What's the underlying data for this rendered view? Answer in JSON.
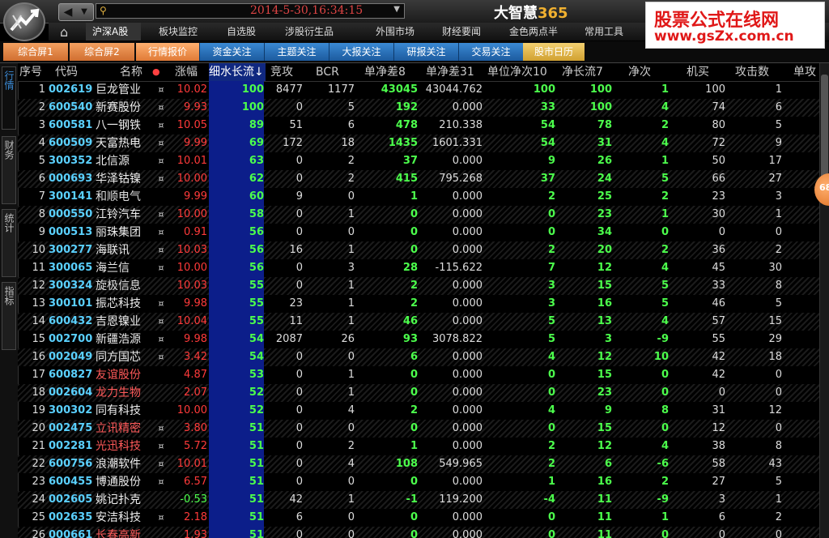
{
  "topbar": {
    "nav_back": "◀",
    "nav_forward": "▼",
    "clock": "2014-5-30,16:34:15",
    "app_title": "大智慧",
    "app_title_num": "365",
    "banner_title": "股票公式在线网",
    "banner_url": "www.gsZx.com.cn"
  },
  "menu": [
    "沪深A股",
    "板块监控",
    "自选股",
    "涉股衍生品",
    "外围市场",
    "财经要闻",
    "金色两点半",
    "常用工具"
  ],
  "tabs": [
    "综合屏1",
    "综合屏2",
    "行情报价",
    "资金关注",
    "主题关注",
    "大报关注",
    "研报关注",
    "交易关注",
    "股市日历"
  ],
  "sidetabs": [
    "行情",
    "财务",
    "统计",
    "指标"
  ],
  "float_label": "68",
  "columns": [
    "序号",
    "代码",
    "名称",
    "●",
    "涨幅",
    "细水长流↓",
    "竞攻",
    "BCR",
    "单净差8",
    "单净差31",
    "单位净次10",
    "净长流7",
    "净次",
    "机买",
    "攻击数",
    "单攻"
  ],
  "rows": [
    [
      "1",
      "002619",
      "巨龙管业",
      "¤",
      "10.02",
      "100",
      "8477",
      "1177",
      "43045",
      "43044.762",
      "100",
      "100",
      "1",
      "100",
      "1"
    ],
    [
      "2",
      "600540",
      "新赛股份",
      "¤",
      "9.93",
      "100",
      "0",
      "5",
      "192",
      "0.000",
      "33",
      "100",
      "4",
      "74",
      "6"
    ],
    [
      "3",
      "600581",
      "八一钢铁",
      "¤",
      "10.05",
      "89",
      "51",
      "6",
      "478",
      "210.338",
      "54",
      "78",
      "2",
      "80",
      "5"
    ],
    [
      "4",
      "600509",
      "天富热电",
      "¤",
      "9.99",
      "69",
      "172",
      "18",
      "1435",
      "1601.331",
      "54",
      "31",
      "4",
      "72",
      "9"
    ],
    [
      "5",
      "300352",
      "北信源",
      "¤",
      "10.01",
      "63",
      "0",
      "2",
      "37",
      "0.000",
      "9",
      "26",
      "1",
      "50",
      "17"
    ],
    [
      "6",
      "000693",
      "华泽钴镍",
      "¤",
      "10.00",
      "62",
      "0",
      "2",
      "415",
      "795.268",
      "37",
      "24",
      "5",
      "66",
      "27"
    ],
    [
      "7",
      "300141",
      "和顺电气",
      "",
      "9.99",
      "60",
      "9",
      "0",
      "1",
      "0.000",
      "2",
      "25",
      "2",
      "23",
      "3"
    ],
    [
      "8",
      "000550",
      "江铃汽车",
      "¤",
      "10.00",
      "58",
      "0",
      "1",
      "0",
      "0.000",
      "0",
      "23",
      "1",
      "30",
      "1"
    ],
    [
      "9",
      "000513",
      "丽珠集团",
      "¤",
      "0.91",
      "56",
      "0",
      "0",
      "0",
      "0.000",
      "0",
      "34",
      "0",
      "0",
      "0"
    ],
    [
      "10",
      "300277",
      "海联讯",
      "¤",
      "10.03",
      "56",
      "16",
      "1",
      "0",
      "0.000",
      "2",
      "20",
      "2",
      "36",
      "2"
    ],
    [
      "11",
      "300065",
      "海兰信",
      "¤",
      "10.00",
      "56",
      "0",
      "3",
      "28",
      "-115.622",
      "7",
      "12",
      "4",
      "45",
      "30"
    ],
    [
      "12",
      "300324",
      "旋极信息",
      "",
      "10.03",
      "55",
      "0",
      "1",
      "2",
      "0.000",
      "3",
      "15",
      "5",
      "33",
      "8"
    ],
    [
      "13",
      "300101",
      "振芯科技",
      "¤",
      "9.98",
      "55",
      "23",
      "1",
      "2",
      "0.000",
      "3",
      "16",
      "5",
      "46",
      "5"
    ],
    [
      "14",
      "600432",
      "吉恩镍业",
      "¤",
      "10.04",
      "55",
      "11",
      "1",
      "46",
      "0.000",
      "5",
      "13",
      "4",
      "57",
      "15"
    ],
    [
      "15",
      "002700",
      "新疆浩源",
      "¤",
      "9.98",
      "54",
      "2087",
      "26",
      "93",
      "3078.822",
      "5",
      "3",
      "-9",
      "55",
      "29"
    ],
    [
      "16",
      "002049",
      "同方国芯",
      "¤",
      "3.42",
      "54",
      "0",
      "0",
      "6",
      "0.000",
      "4",
      "12",
      "10",
      "42",
      "18"
    ],
    [
      "17",
      "600827",
      "友谊股份",
      "",
      "4.87",
      "53",
      "0",
      "1",
      "0",
      "0.000",
      "0",
      "15",
      "0",
      "42",
      "0"
    ],
    [
      "18",
      "002604",
      "龙力生物",
      "",
      "2.07",
      "52",
      "0",
      "1",
      "0",
      "0.000",
      "0",
      "23",
      "0",
      "0",
      "0"
    ],
    [
      "19",
      "300302",
      "同有科技",
      "",
      "10.00",
      "52",
      "0",
      "4",
      "2",
      "0.000",
      "4",
      "9",
      "8",
      "31",
      "12"
    ],
    [
      "20",
      "002475",
      "立讯精密",
      "¤",
      "3.80",
      "51",
      "0",
      "0",
      "0",
      "0.000",
      "0",
      "15",
      "0",
      "12",
      "0"
    ],
    [
      "21",
      "002281",
      "光迅科技",
      "¤",
      "5.72",
      "51",
      "0",
      "2",
      "1",
      "0.000",
      "2",
      "12",
      "4",
      "38",
      "8"
    ],
    [
      "22",
      "600756",
      "浪潮软件",
      "¤",
      "10.01",
      "51",
      "0",
      "4",
      "108",
      "549.965",
      "2",
      "6",
      "-6",
      "58",
      "43"
    ],
    [
      "23",
      "600455",
      "博通股份",
      "¤",
      "6.57",
      "51",
      "0",
      "0",
      "0",
      "0.000",
      "1",
      "16",
      "2",
      "27",
      "5"
    ],
    [
      "24",
      "002605",
      "姚记扑克",
      "",
      "-0.53",
      "51",
      "42",
      "1",
      "-1",
      "119.200",
      "-4",
      "11",
      "-9",
      "3",
      "1"
    ],
    [
      "25",
      "002635",
      "安洁科技",
      "¤",
      "2.18",
      "51",
      "6",
      "0",
      "0",
      "0.000",
      "0",
      "11",
      "1",
      "6",
      "2"
    ],
    [
      "26",
      "000661",
      "长春高新",
      "",
      "1.93",
      "51",
      "0",
      "0",
      "0",
      "0.000",
      "0",
      "11",
      "0",
      "0",
      "0"
    ]
  ]
}
